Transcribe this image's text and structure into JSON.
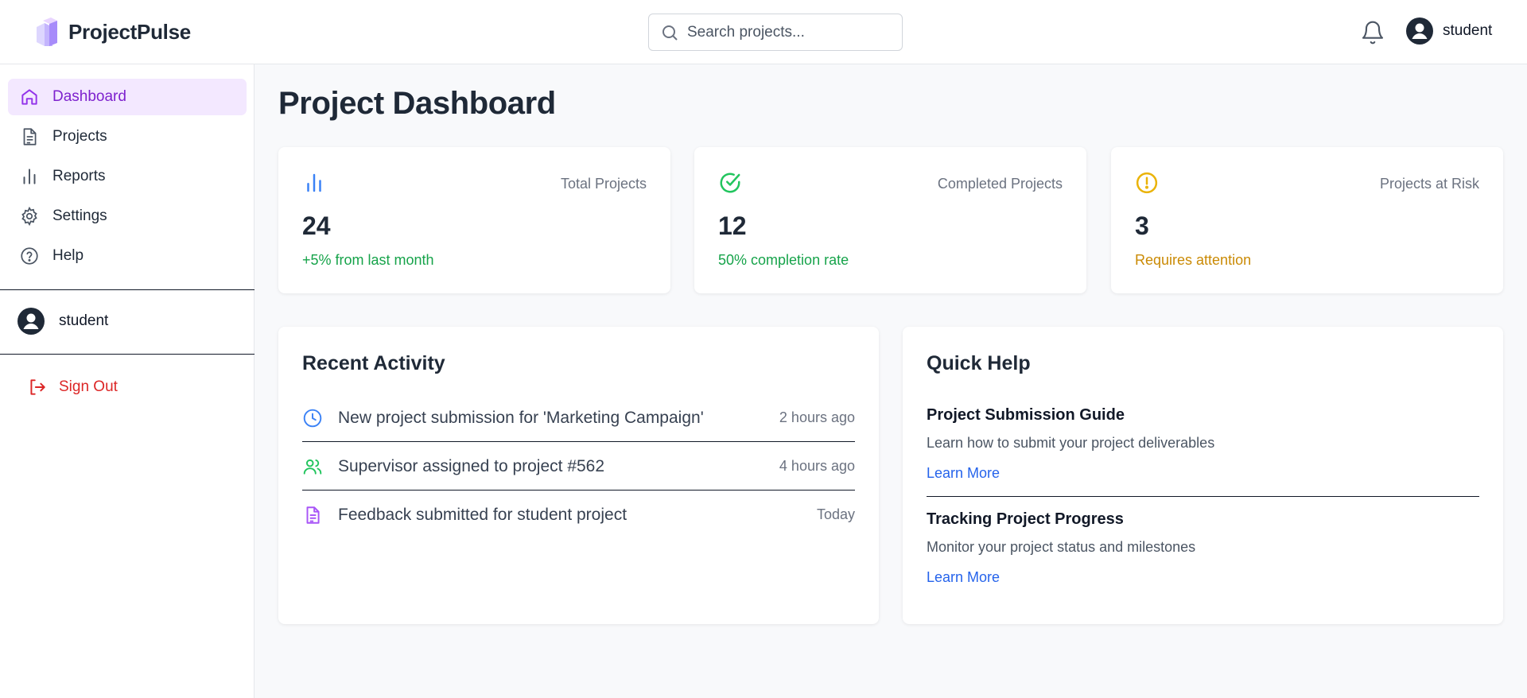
{
  "app": {
    "name": "ProjectPulse"
  },
  "header": {
    "search_placeholder": "Search projects...",
    "username": "student"
  },
  "sidebar": {
    "items": [
      {
        "label": "Dashboard",
        "icon": "home-icon",
        "active": true
      },
      {
        "label": "Projects",
        "icon": "document-icon"
      },
      {
        "label": "Reports",
        "icon": "bar-chart-icon"
      },
      {
        "label": "Settings",
        "icon": "gear-icon"
      },
      {
        "label": "Help",
        "icon": "help-circle-icon"
      }
    ],
    "username": "student",
    "sign_out": "Sign Out"
  },
  "main": {
    "title": "Project Dashboard",
    "stats": [
      {
        "label": "Total Projects",
        "value": "24",
        "note": "+5% from last month",
        "note_color": "#16a34a",
        "icon": "bar-chart-icon",
        "icon_color": "#3b82f6"
      },
      {
        "label": "Completed Projects",
        "value": "12",
        "note": "50% completion rate",
        "note_color": "#16a34a",
        "icon": "check-circle-icon",
        "icon_color": "#22c55e"
      },
      {
        "label": "Projects at Risk",
        "value": "3",
        "note": "Requires attention",
        "note_color": "#ca8a04",
        "icon": "alert-circle-icon",
        "icon_color": "#eab308"
      }
    ],
    "recent_activity": {
      "title": "Recent Activity",
      "items": [
        {
          "text": "New project submission for 'Marketing Campaign'",
          "time": "2 hours ago",
          "icon": "clock-icon"
        },
        {
          "text": "Supervisor assigned to project #562",
          "time": "4 hours ago",
          "icon": "users-icon"
        },
        {
          "text": "Feedback submitted for student project",
          "time": "Today",
          "icon": "document-icon"
        }
      ]
    },
    "quick_help": {
      "title": "Quick Help",
      "items": [
        {
          "title": "Project Submission Guide",
          "description": "Learn how to submit your project deliverables",
          "link": "Learn More"
        },
        {
          "title": "Tracking Project Progress",
          "description": "Monitor your project status and milestones",
          "link": "Learn More"
        }
      ]
    }
  }
}
